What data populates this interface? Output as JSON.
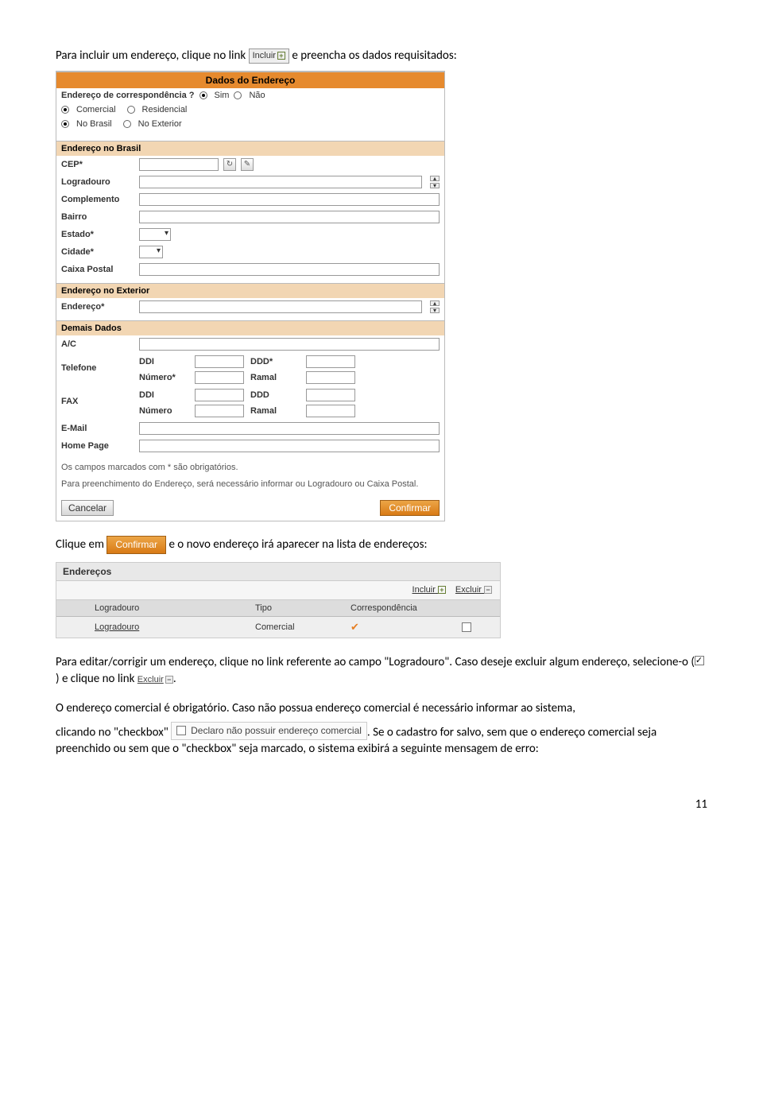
{
  "intro": {
    "line1a": "Para incluir um endereço, clique no link ",
    "incluir_label": "Incluir",
    "line1b": " e preencha os dados requisitados:"
  },
  "form": {
    "header": "Dados do Endereço",
    "q_corr": "Endereço de correspondência ?",
    "sim": "Sim",
    "nao": "Não",
    "comercial": "Comercial",
    "residencial": "Residencial",
    "nobrasil": "No Brasil",
    "noexterior": "No Exterior",
    "sec_brasil": "Endereço no Brasil",
    "cep": "CEP*",
    "logradouro": "Logradouro",
    "complemento": "Complemento",
    "bairro": "Bairro",
    "estado": "Estado*",
    "cidade": "Cidade*",
    "caixa_postal": "Caixa Postal",
    "sec_exterior": "Endereço no Exterior",
    "endereco": "Endereço*",
    "sec_demais": "Demais Dados",
    "ac": "A/C",
    "telefone": "Telefone",
    "fax": "FAX",
    "ddi": "DDI",
    "ddd_req": "DDD*",
    "ddd": "DDD",
    "numero_req": "Número*",
    "numero": "Número",
    "ramal": "Ramal",
    "email": "E-Mail",
    "homepage": "Home Page",
    "note1": "Os campos marcados com * são obrigatórios.",
    "note2": "Para preenchimento do Endereço, será necessário informar ou Logradouro ou Caixa Postal.",
    "cancelar": "Cancelar",
    "confirmar": "Confirmar"
  },
  "mid": {
    "a": "Clique em ",
    "b": " e o novo endereço irá aparecer na lista de endereços:"
  },
  "table": {
    "title": "Endereços",
    "incluir": "Incluir",
    "excluir": "Excluir",
    "col_log": "Logradouro",
    "col_tipo": "Tipo",
    "col_corr": "Correspondência",
    "row_log": "Logradouro",
    "row_tipo": "Comercial"
  },
  "para2": {
    "a": "Para editar/corrigir um endereço, clique no link referente ao campo \"Logradouro\". Caso deseje excluir algum endereço, selecione-o (",
    "b": ") e clique no link ",
    "excluir_label": "Excluir",
    "c": "."
  },
  "para3": {
    "a": "O endereço comercial é obrigatório. Caso não possua endereço comercial é necessário informar ao sistema,",
    "b": "clicando no \"checkbox\" ",
    "declaro": "Declaro não possuir endereço comercial",
    "c": ". Se o cadastro for salvo, sem que o endereço comercial seja preenchido ou sem que o \"checkbox\" seja marcado, o sistema exibirá a seguinte mensagem de erro:"
  },
  "pagenum": "11"
}
